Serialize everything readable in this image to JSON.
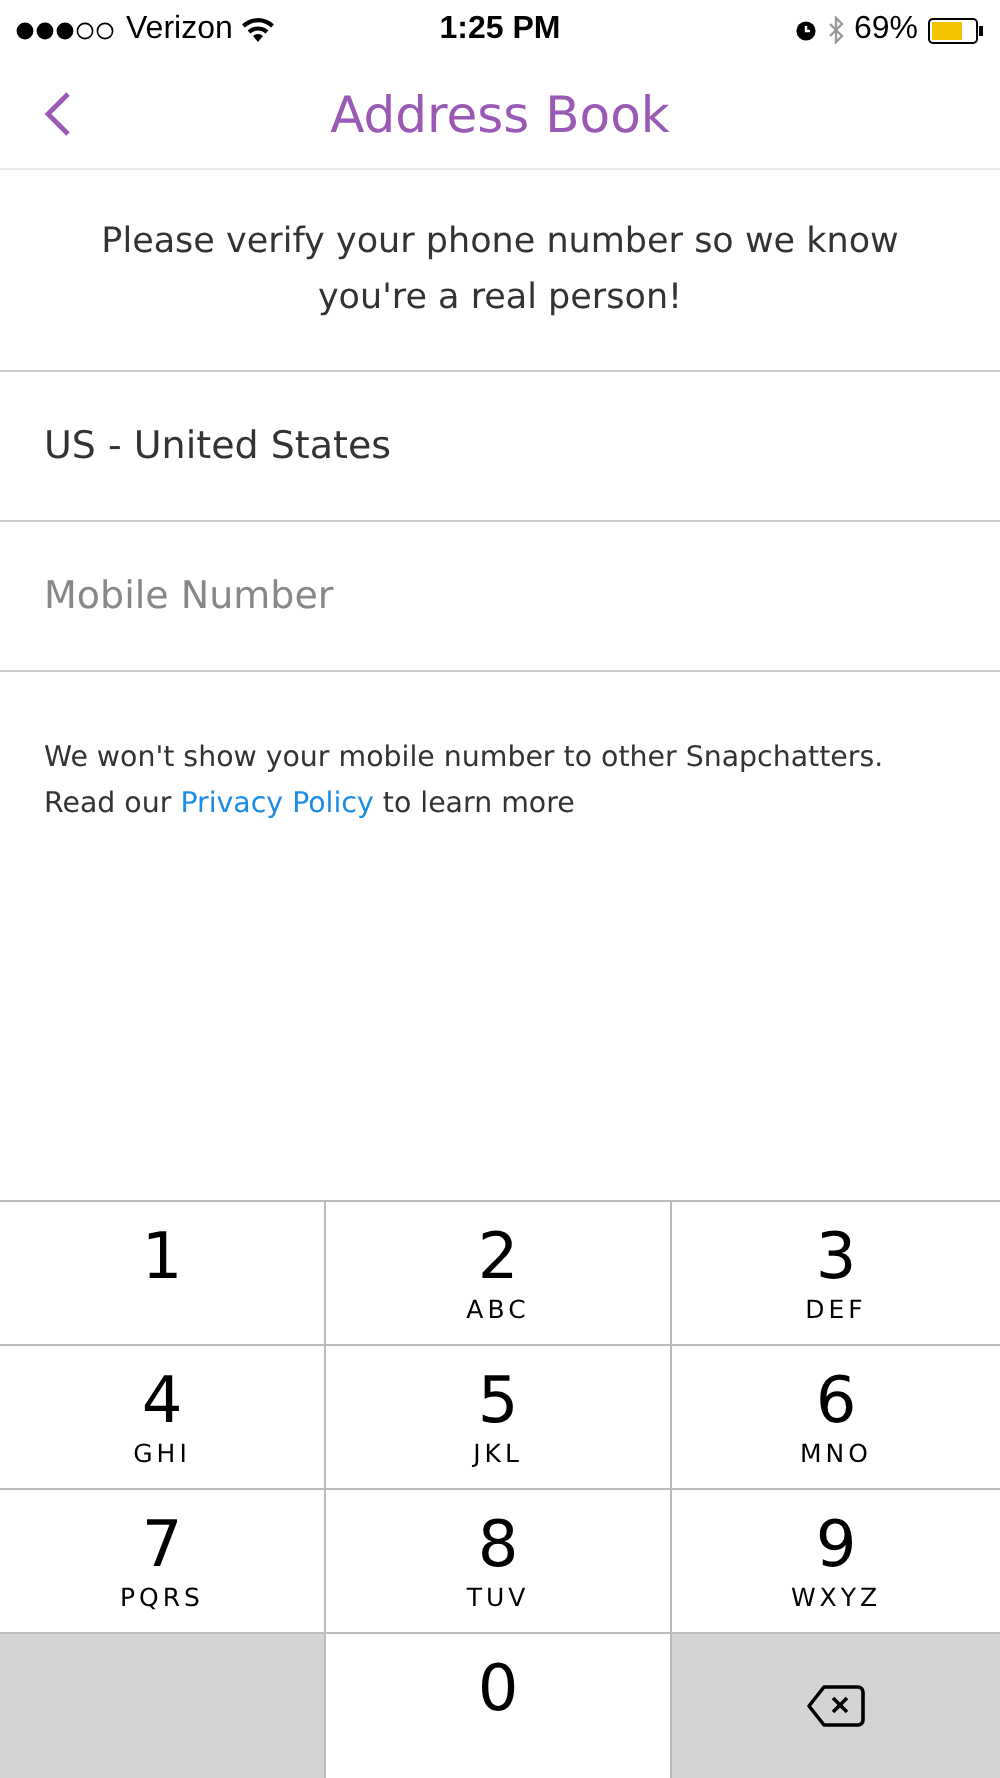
{
  "status_bar": {
    "carrier": "Verizon",
    "time": "1:25 PM",
    "battery": "69%"
  },
  "nav": {
    "title": "Address Book"
  },
  "message": "Please verify your phone number so we know you're a real person!",
  "country": {
    "value": "US - United States"
  },
  "phone": {
    "placeholder": "Mobile Number"
  },
  "note": {
    "before": "We won't show your mobile number to other Snapchatters. Read our ",
    "link": "Privacy Policy",
    "after": " to learn more"
  },
  "keypad": [
    {
      "kind": "digit",
      "digit": "1"
    },
    {
      "kind": "digit",
      "digit": "2",
      "letters": "ABC"
    },
    {
      "kind": "digit",
      "digit": "3",
      "letters": "DEF"
    },
    {
      "kind": "digit",
      "digit": "4",
      "letters": "GHI"
    },
    {
      "kind": "digit",
      "digit": "5",
      "letters": "JKL"
    },
    {
      "kind": "digit",
      "digit": "6",
      "letters": "MNO"
    },
    {
      "kind": "digit",
      "digit": "7",
      "letters": "PQRS"
    },
    {
      "kind": "digit",
      "digit": "8",
      "letters": "TUV"
    },
    {
      "kind": "digit",
      "digit": "9",
      "letters": "WXYZ"
    },
    {
      "kind": "blank"
    },
    {
      "kind": "digit",
      "digit": "0"
    },
    {
      "kind": "delete"
    }
  ]
}
